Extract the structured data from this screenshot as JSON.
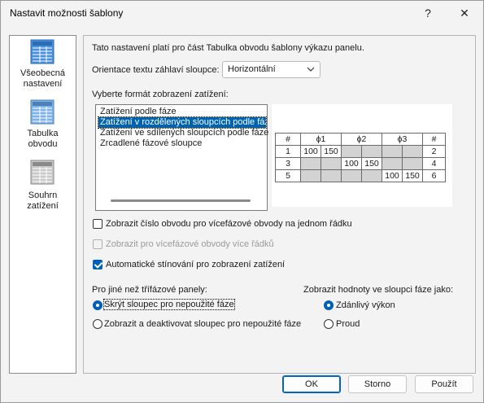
{
  "window": {
    "title": "Nastavit možnosti šablony",
    "help_label": "?",
    "close_label": "✕"
  },
  "nav": {
    "items": [
      {
        "label_line1": "Všeobecná",
        "label_line2": "nastavení",
        "icon": "general-settings-icon"
      },
      {
        "label_line1": "Tabulka",
        "label_line2": "obvodu",
        "icon": "circuit-table-icon"
      },
      {
        "label_line1": "Souhrn",
        "label_line2": "zatížení",
        "icon": "load-summary-icon"
      }
    ]
  },
  "panel": {
    "intro": "Tato nastavení platí pro část Tabulka obvodu šablony výkazu panelu.",
    "orientation_label": "Orientace textu záhlaví sloupce:",
    "orientation_value": "Horizontální",
    "format_label": "Vyberte formát zobrazení zatížení:",
    "format_options": [
      "Zatížení podle fáze",
      "Zatížení v rozdělených sloupcích podle fáze",
      "Zatížení ve sdílených sloupcích podle fáze",
      "Zrcadlené fázové sloupce"
    ],
    "selected_format_index": 1,
    "preview": {
      "headers": [
        "#",
        "ϕ1",
        "ϕ2",
        "ϕ3",
        "#"
      ],
      "rows": [
        {
          "left": "1",
          "cells": [
            "100",
            "150",
            "",
            "",
            "",
            ""
          ],
          "right": "2"
        },
        {
          "left": "3",
          "cells": [
            "",
            "",
            "100",
            "150",
            "",
            ""
          ],
          "right": "4"
        },
        {
          "left": "5",
          "cells": [
            "",
            "",
            "",
            "",
            "100",
            "150"
          ],
          "right": "6"
        }
      ]
    },
    "checkboxes": [
      {
        "label": "Zobrazit číslo obvodu pro vícefázové obvody na jednom řádku",
        "checked": false,
        "enabled": true
      },
      {
        "label": "Zobrazit pro vícefázové obvody více řádků",
        "checked": false,
        "enabled": false
      },
      {
        "label": "Automatické stínování pro zobrazení zatížení",
        "checked": true,
        "enabled": true
      }
    ],
    "non_three_phase_label": "Pro jiné než třífázové panely:",
    "non_three_phase_options": [
      {
        "label": "Skrýt sloupec pro nepoužité fáze",
        "selected": true
      },
      {
        "label": "Zobrazit a deaktivovat sloupec pro nepoužité fáze",
        "selected": false
      }
    ],
    "phase_values_label": "Zobrazit hodnoty ve sloupci fáze jako:",
    "phase_values_options": [
      {
        "label": "Zdánlivý výkon",
        "selected": true
      },
      {
        "label": "Proud",
        "selected": false
      }
    ]
  },
  "buttons": {
    "ok": "OK",
    "cancel": "Storno",
    "apply": "Použít"
  },
  "colors": {
    "selection": "#0063b1",
    "accent": "#005fb8",
    "shading": "#d3d3d3"
  }
}
